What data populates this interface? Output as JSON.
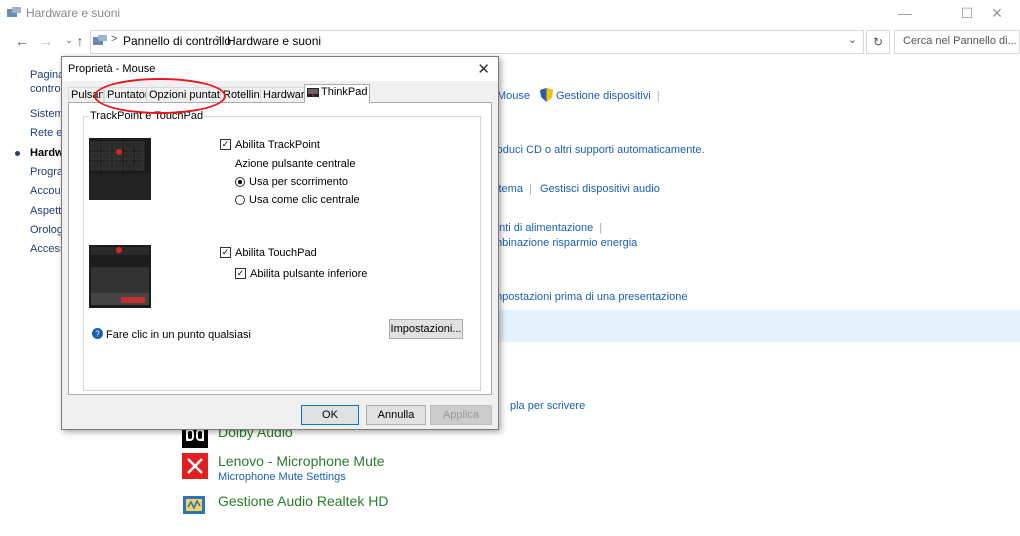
{
  "window": {
    "title": "Hardware e suoni"
  },
  "address": {
    "crumbs": [
      "Pannello di controllo",
      "Hardware e suoni"
    ],
    "search_placeholder": "Cerca nel Pannello di..."
  },
  "leftnav": {
    "items": [
      "Pagina",
      "controll",
      "Sistema",
      "Rete e",
      "Hardwa",
      "Progra",
      "Accoun",
      "Aspetto",
      "Orolog",
      "Accessi"
    ]
  },
  "content_links": {
    "devices": [
      "Mouse",
      "Gestione dispositivi"
    ],
    "autoplay": "roduci CD o altri supporti automaticamente.",
    "sound": [
      "stema",
      "Gestisci dispositivi audio"
    ],
    "power1": "anti di alimentazione",
    "power2": "mbinazione risparmio energia",
    "presentation": "mpostazioni prima di una presentazione",
    "pen": "pla per scrivere"
  },
  "bottom_items": [
    {
      "title": "Dolby Audio",
      "sub": ""
    },
    {
      "title": "Lenovo - Microphone Mute",
      "sub": "Microphone Mute Settings"
    },
    {
      "title": "Gestione Audio Realtek HD",
      "sub": ""
    }
  ],
  "dialog": {
    "title": "Proprietà - Mouse",
    "tabs": [
      "Pulsan",
      "Puntatori",
      "Opzioni puntatore",
      "Rotellina",
      "Hardware",
      "ThinkPad"
    ],
    "group_label": "TrackPoint e TouchPad",
    "trackpoint": {
      "enable": "Abilita TrackPoint",
      "middle_action": "Azione pulsante centrale",
      "opt_scroll": "Usa per scorrimento",
      "opt_click": "Usa come clic centrale"
    },
    "touchpad": {
      "enable": "Abilita TouchPad",
      "lower_button": "Abilita pulsante inferiore"
    },
    "help_text": "Fare clic in un punto qualsiasi",
    "settings_button": "Impostazioni...",
    "ok": "OK",
    "cancel": "Annulla",
    "apply": "Applica"
  },
  "colors": {
    "accent": "#1a5fb4",
    "highlight": "#e5f1fb",
    "annotation": "#e8161c"
  }
}
